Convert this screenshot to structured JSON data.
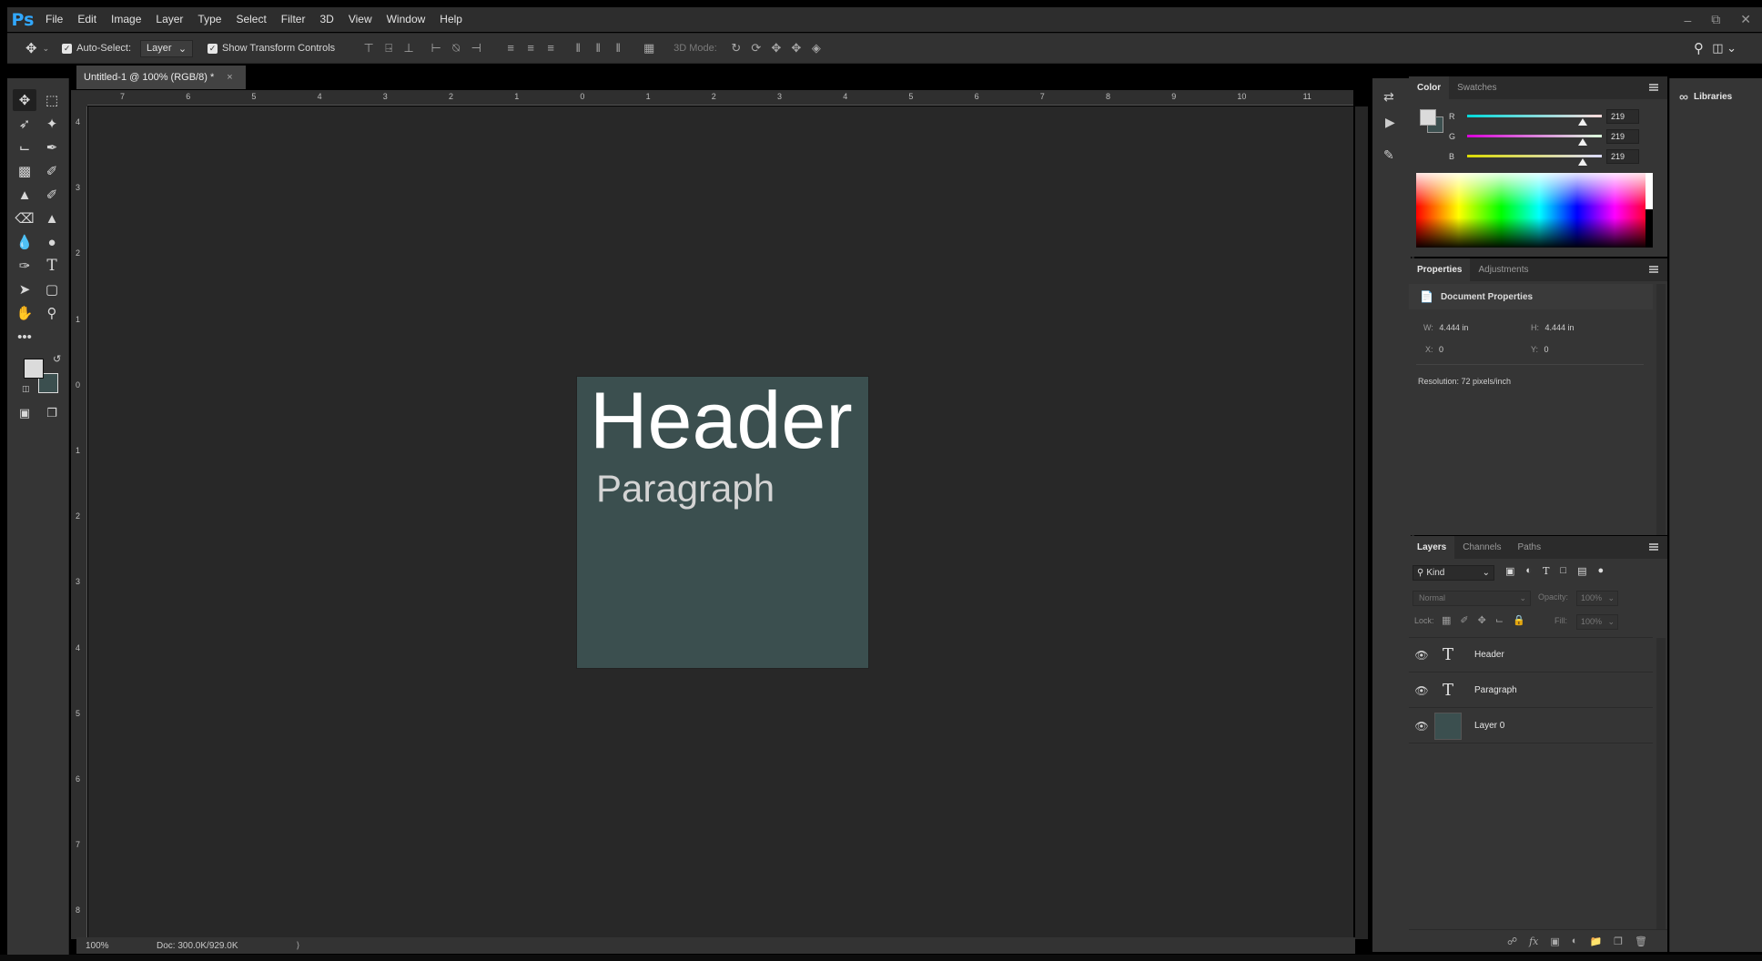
{
  "app": {
    "logo": "Ps"
  },
  "menu": [
    "File",
    "Edit",
    "Image",
    "Layer",
    "Type",
    "Select",
    "Filter",
    "3D",
    "View",
    "Window",
    "Help"
  ],
  "window_controls": [
    "minimize-icon",
    "restore-icon",
    "close-icon"
  ],
  "options_bar": {
    "auto_select_label": "Auto-Select:",
    "auto_select_target": "Layer",
    "show_transform_label": "Show Transform Controls",
    "mode_3d_label": "3D Mode:"
  },
  "document": {
    "tab_title": "Untitled-1 @ 100% (RGB/8) *",
    "zoom": "100%",
    "doc_size": "Doc: 300.0K/929.0K",
    "canvas_bg": "#3b4f4f",
    "header_text": "Header",
    "paragraph_text": "Paragraph",
    "h_ruler_labels": [
      "7",
      "6",
      "5",
      "4",
      "3",
      "2",
      "1",
      "0",
      "1",
      "2",
      "3",
      "4",
      "5",
      "6",
      "7",
      "8",
      "9",
      "10",
      "11"
    ],
    "v_ruler_labels": [
      "4",
      "3",
      "2",
      "1",
      "0",
      "1",
      "2",
      "3",
      "4",
      "5",
      "6",
      "7",
      "8"
    ]
  },
  "color_panel": {
    "tabs": [
      "Color",
      "Swatches"
    ],
    "active_tab": "Color",
    "channels": [
      {
        "label": "R",
        "value": "219",
        "level": 0.86
      },
      {
        "label": "G",
        "value": "219",
        "level": 0.86
      },
      {
        "label": "B",
        "value": "219",
        "level": 0.86
      }
    ],
    "foreground": "#dbdbdb",
    "background": "#3b4f4f"
  },
  "properties_panel": {
    "tabs": [
      "Properties",
      "Adjustments"
    ],
    "active_tab": "Properties",
    "section_title": "Document Properties",
    "w_label": "W:",
    "w_value": "4.444 in",
    "h_label": "H:",
    "h_value": "4.444 in",
    "x_label": "X:",
    "x_value": "0",
    "y_label": "Y:",
    "y_value": "0",
    "resolution": "Resolution: 72 pixels/inch"
  },
  "layers_panel": {
    "tabs": [
      "Layers",
      "Channels",
      "Paths"
    ],
    "active_tab": "Layers",
    "kind_filter": "Kind",
    "blend_mode": "Normal",
    "opacity_label": "Opacity:",
    "opacity_value": "100%",
    "lock_label": "Lock:",
    "fill_label": "Fill:",
    "fill_value": "100%",
    "layers": [
      {
        "name": "Header",
        "type": "text"
      },
      {
        "name": "Paragraph",
        "type": "text"
      },
      {
        "name": "Layer 0",
        "type": "pixel",
        "color": "#3b4f4f"
      }
    ]
  },
  "libraries": {
    "label": "Libraries"
  }
}
